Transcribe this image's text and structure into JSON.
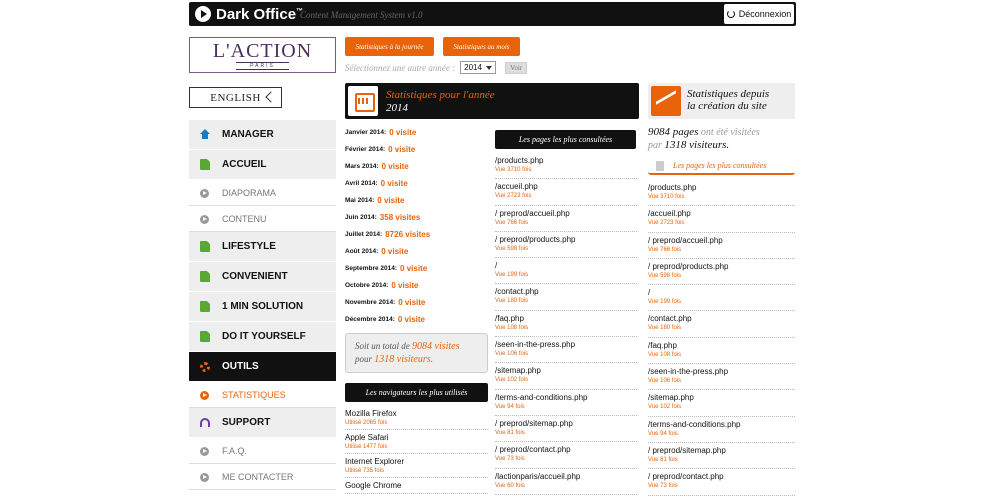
{
  "topbar": {
    "brand": "Dark Office",
    "tm": "™",
    "subtitle": "Content Management System v1.0",
    "logout_label": "Déconnexion"
  },
  "logo": {
    "line1": "L'ACTION",
    "line2": "PARIS"
  },
  "lang": {
    "label": "ENGLISH"
  },
  "nav": [
    {
      "label": "MANAGER",
      "icon": "home-icon",
      "kind": "main"
    },
    {
      "label": "ACCUEIL",
      "icon": "document-icon",
      "kind": "main"
    },
    {
      "label": "DIAPORAMA",
      "icon": "arrow-circle-icon",
      "kind": "sub"
    },
    {
      "label": "CONTENU",
      "icon": "arrow-circle-icon",
      "kind": "sub"
    },
    {
      "label": "LIFESTYLE",
      "icon": "document-icon",
      "kind": "main"
    },
    {
      "label": "CONVENIENT",
      "icon": "document-icon",
      "kind": "main"
    },
    {
      "label": "1 MIN SOLUTION",
      "icon": "document-icon",
      "kind": "main"
    },
    {
      "label": "DO IT YOURSELF",
      "icon": "document-icon",
      "kind": "main"
    },
    {
      "label": "OUTILS",
      "icon": "gear-icon",
      "kind": "active"
    },
    {
      "label": "STATISTIQUES",
      "icon": "arrow-circle-icon",
      "kind": "subactive"
    },
    {
      "label": "SUPPORT",
      "icon": "headset-icon",
      "kind": "main"
    },
    {
      "label": "F.A.Q.",
      "icon": "arrow-circle-icon",
      "kind": "sub"
    },
    {
      "label": "ME CONTACTER",
      "icon": "arrow-circle-icon",
      "kind": "sub"
    }
  ],
  "buttons": {
    "day": "Statistiques à la journée",
    "month": "Statistiques au mois"
  },
  "year_select": {
    "prompt": "Sélectionnez une autre année :",
    "value": "2014",
    "go": "Voir"
  },
  "year_stats": {
    "title": "Statistiques pour l'année",
    "year": "2014"
  },
  "months": [
    {
      "name": "Janvier 2014:",
      "value": "0 visite"
    },
    {
      "name": "Février 2014:",
      "value": "0 visite"
    },
    {
      "name": "Mars 2014:",
      "value": "0 visite"
    },
    {
      "name": "Avril 2014:",
      "value": "0 visite"
    },
    {
      "name": "Mai 2014:",
      "value": "0 visite"
    },
    {
      "name": "Juin 2014:",
      "value": "358 visites"
    },
    {
      "name": "Juillet 2014:",
      "value": "8726 visites"
    },
    {
      "name": "Août 2014:",
      "value": "0 visite"
    },
    {
      "name": "Septembre 2014:",
      "value": "0 visite"
    },
    {
      "name": "Octobre 2014:",
      "value": "0 visite"
    },
    {
      "name": "Novembre 2014:",
      "value": "0 visite"
    },
    {
      "name": "Décembre 2014:",
      "value": "0 visite"
    }
  ],
  "total": {
    "prefix": "Soit un total de",
    "visits": "9084 visites",
    "mid": "pour",
    "visitors": "1318 visiteurs."
  },
  "browsers": {
    "title": "Les navigateurs les plus utilisés",
    "items": [
      {
        "name": "Mozilla Firefox",
        "count": "Utilisé 2065 fois"
      },
      {
        "name": "Apple Safari",
        "count": "Utilisé 1477 fois"
      },
      {
        "name": "Internet Explorer",
        "count": "Utilisé 735 fois"
      },
      {
        "name": "Google Chrome",
        "count": ""
      }
    ]
  },
  "year_pages": {
    "title": "Les pages les plus consultées",
    "items": [
      {
        "name": "/products.php",
        "count": "Vue 3710 fois"
      },
      {
        "name": "/accueil.php",
        "count": "Vue 2723 fois"
      },
      {
        "name": "/  preprod/accueil.php",
        "count": "Vue 766 fois"
      },
      {
        "name": "/  preprod/products.php",
        "count": "Vue 598 fois"
      },
      {
        "name": "/",
        "count": "Vue 199 fois"
      },
      {
        "name": "/contact.php",
        "count": "Vue 180 fois"
      },
      {
        "name": "/faq.php",
        "count": "Vue 108 fois"
      },
      {
        "name": "/seen-in-the-press.php",
        "count": "Vue 106 fois"
      },
      {
        "name": "/sitemap.php",
        "count": "Vue 102 fois"
      },
      {
        "name": "/terms-and-conditions.php",
        "count": "Vue 94 fois"
      },
      {
        "name": "/  preprod/sitemap.php",
        "count": "Vue 81 fois"
      },
      {
        "name": "/  preprod/contact.php",
        "count": "Vue 73 fois"
      },
      {
        "name": "/lactionparis/accueil.php",
        "count": "Vue 60 fois"
      }
    ]
  },
  "site_stats": {
    "title_line1": "Statistiques depuis",
    "title_line2": "la création du site",
    "pages": "9084 pages",
    "mid1": "ont été visitées",
    "mid2": "par",
    "visitors": "1318 visiteurs.",
    "pages_title": "Les pages les plus consultées",
    "items": [
      {
        "name": "/products.php",
        "count": "Vue 3710 fois"
      },
      {
        "name": "/accueil.php",
        "count": "Vue 2723 fois"
      },
      {
        "name": "/  preprod/accueil.php",
        "count": "Vue 766 fois"
      },
      {
        "name": "/  preprod/products.php",
        "count": "Vue 598 fois"
      },
      {
        "name": "/",
        "count": "Vue 199 fois"
      },
      {
        "name": "/contact.php",
        "count": "Vue 180 fois"
      },
      {
        "name": "/faq.php",
        "count": "Vue 108 fois"
      },
      {
        "name": "/seen-in-the-press.php",
        "count": "Vue 106 fois"
      },
      {
        "name": "/sitemap.php",
        "count": "Vue 102 fois"
      },
      {
        "name": "/terms-and-conditions.php",
        "count": "Vue 94 fois"
      },
      {
        "name": "/  preprod/sitemap.php",
        "count": "Vue 81 fois"
      },
      {
        "name": "/  preprod/contact.php",
        "count": "Vue 73 fois"
      }
    ]
  },
  "colors": {
    "accent": "#e8630a",
    "dark": "#111111",
    "logo": "#4a2e5e"
  }
}
